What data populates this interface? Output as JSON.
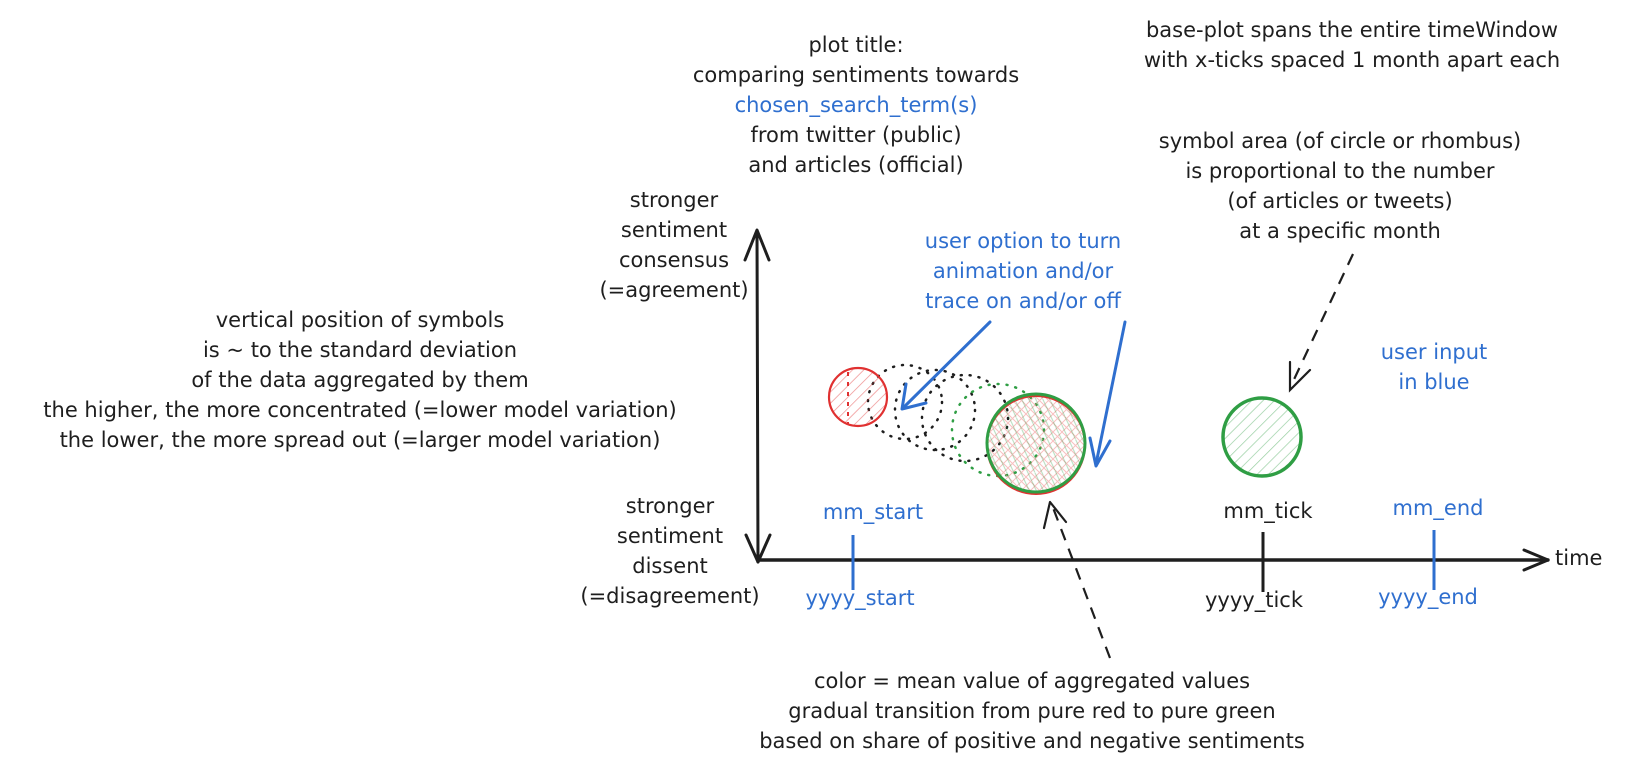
{
  "colors": {
    "ink": "#1e1e1e",
    "user_input_blue": "#2f6fcf",
    "red": "#e03131",
    "green": "#2f9e44"
  },
  "title_note": {
    "line1": "plot title:",
    "line2": "comparing sentiments towards",
    "line3": "chosen_search_term(s)",
    "line4": "from twitter (public)",
    "line5": "and articles (official)"
  },
  "base_plot_note": {
    "line1": "base-plot spans the entire timeWindow",
    "line2": "with x-ticks spaced 1 month apart each"
  },
  "symbol_area_note": {
    "line1": "symbol area (of circle or rhombus)",
    "line2": "is proportional to the number",
    "line3": "(of articles or tweets)",
    "line4": "at a specific month"
  },
  "y_axis": {
    "top": {
      "line1": "stronger",
      "line2": "sentiment",
      "line3": "consensus",
      "line4": "(=agreement)"
    },
    "bottom": {
      "line1": "stronger",
      "line2": "sentiment",
      "line3": "dissent",
      "line4": "(=disagreement)"
    }
  },
  "x_axis": {
    "label": "time"
  },
  "vertical_note": {
    "line1": "vertical position of symbols",
    "line2": "is ~ to the standard deviation",
    "line3": "of the data aggregated by them",
    "line4": "the higher, the more concentrated (=lower model variation)",
    "line5": "the lower, the more spread out (=larger model variation)"
  },
  "animation_note": {
    "line1": "user option to turn",
    "line2": "animation and/or",
    "line3": "trace on and/or off"
  },
  "user_input_note": {
    "line1": "user input",
    "line2": "in blue"
  },
  "ticks": [
    {
      "month": "mm_start",
      "year": "yyyy_start",
      "user_input": true
    },
    {
      "month": "mm_tick",
      "year": "yyyy_tick",
      "user_input": false
    },
    {
      "month": "mm_end",
      "year": "yyyy_end",
      "user_input": true
    }
  ],
  "color_note": {
    "line1": "color = mean value of aggregated values",
    "line2": "gradual transition from pure red to pure green",
    "line3": "based on share of positive and negative sentiments"
  }
}
